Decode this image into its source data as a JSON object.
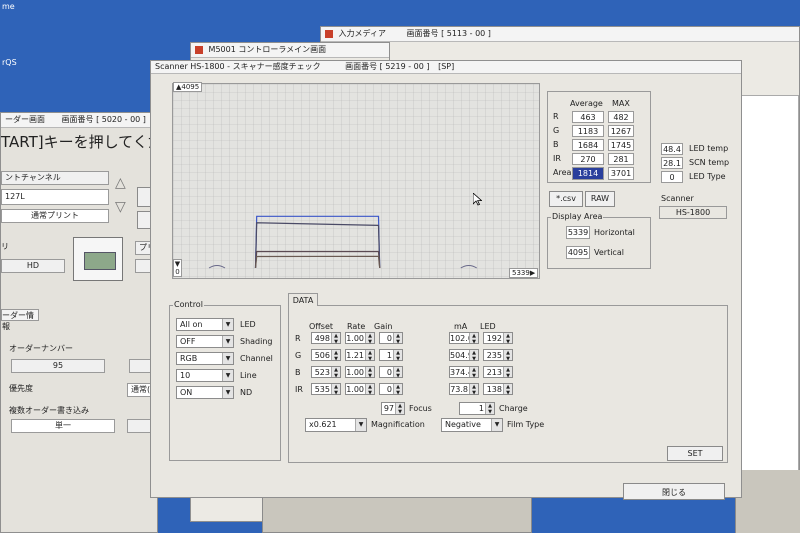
{
  "desktop": {
    "corner_text_1": "me",
    "corner_text_2": "rQS"
  },
  "bg_window_left": {
    "title_suffix": "ーダー画面",
    "screen_no": "画面番号 [ 5020 - 00 ]",
    "prompt": "TART]キーを押してくだ",
    "channel_label": "ントチャンネル",
    "value_127l": "127L",
    "print_mode": "通常プリント",
    "fragment_ri": "リ",
    "hd_value": "HD",
    "fragment_pri": "プリ",
    "order_info_tab": "ーダー情報",
    "order_number_label": "オーダーナンバー",
    "order_number_value": "95",
    "priority_label": "優先度",
    "priority_value": "通常(",
    "multi_order_label": "複数オーダー書き込み",
    "multi_order_value": "単一"
  },
  "bg_window_m5001": {
    "title": "M5001 コントローラメイン画面"
  },
  "bg_window_input": {
    "title": "入力メディア",
    "screen_no": "画面番号 [ 5113 - 00 ]"
  },
  "scanner_window": {
    "title": "Scanner HS-1800 - スキャナー感度チェック",
    "screen_no": "画面番号 [ 5219 - 00 ]",
    "tag": "[SP]",
    "close_button": "閉じる"
  },
  "plot": {
    "y_max_label": "4095",
    "x_max_label": "5339",
    "y_zero_label": "0"
  },
  "chart_data": {
    "type": "line",
    "xlim": [
      0,
      5339
    ],
    "ylim": [
      0,
      4095
    ],
    "grid": true,
    "series": [
      {
        "color": "#3b56c8",
        "points": [
          [
            1100,
            0
          ],
          [
            1120,
            1190
          ],
          [
            3020,
            1190
          ],
          [
            3040,
            0
          ]
        ]
      },
      {
        "color": "#4a4a66",
        "points": [
          [
            1100,
            0
          ],
          [
            1120,
            1040
          ],
          [
            3020,
            980
          ],
          [
            3040,
            0
          ]
        ]
      },
      {
        "color": "#5b4a52",
        "points": [
          [
            1100,
            0
          ],
          [
            1120,
            380
          ],
          [
            3020,
            380
          ],
          [
            3040,
            0
          ]
        ]
      },
      {
        "color": "#6a5a52",
        "points": [
          [
            1100,
            0
          ],
          [
            1120,
            265
          ],
          [
            3020,
            270
          ],
          [
            3040,
            0
          ]
        ]
      }
    ]
  },
  "stats": {
    "header_average": "Average",
    "header_max": "MAX",
    "rows": [
      {
        "label": "R",
        "avg": "463",
        "max": "482"
      },
      {
        "label": "G",
        "avg": "1183",
        "max": "1267"
      },
      {
        "label": "B",
        "avg": "1684",
        "max": "1745"
      },
      {
        "label": "IR",
        "avg": "270",
        "max": "281"
      }
    ],
    "area_label": "Area",
    "area_value": "1814",
    "area_max": "3701"
  },
  "sensors": [
    {
      "value": "48.4",
      "label": "LED temp"
    },
    {
      "value": "28.1",
      "label": "SCN temp"
    },
    {
      "value": "0",
      "label": "LED Type"
    }
  ],
  "buttons": {
    "csv": "*.csv",
    "raw": "RAW",
    "set": "SET"
  },
  "scanner_info": {
    "label": "Scanner",
    "value": "HS-1800"
  },
  "display_area": {
    "title": "Display Area",
    "horizontal_value": "5339",
    "horizontal_label": "Horizontal",
    "vertical_value": "4095",
    "vertical_label": "Vertical"
  },
  "control": {
    "title": "Control",
    "rows": [
      {
        "value": "All on",
        "label": "LED"
      },
      {
        "value": "OFF",
        "label": "Shading"
      },
      {
        "value": "RGB",
        "label": "Channel"
      },
      {
        "value": "10",
        "label": "Line"
      },
      {
        "value": "ON",
        "label": "ND"
      }
    ]
  },
  "data_panel": {
    "tab": "DATA",
    "col_offset": "Offset",
    "col_rate": "Rate",
    "col_gain": "Gain",
    "col_ma": "mA",
    "col_led": "LED",
    "rows": [
      {
        "label": "R",
        "offset": "498",
        "rate": "1.00",
        "gain": "0",
        "ma": "102.0",
        "led": "192"
      },
      {
        "label": "G",
        "offset": "506",
        "rate": "1.21",
        "gain": "1",
        "ma": "504.9",
        "led": "235"
      },
      {
        "label": "B",
        "offset": "523",
        "rate": "1.00",
        "gain": "0",
        "ma": "374.4",
        "led": "213"
      },
      {
        "label": "IR",
        "offset": "535",
        "rate": "1.00",
        "gain": "0",
        "ma": "73.8",
        "led": "138"
      }
    ],
    "focus_value": "97",
    "focus_label": "Focus",
    "charge_value": "1",
    "charge_label": "Charge",
    "magnification_value": "x0.621",
    "magnification_label": "Magnification",
    "film_type_value": "Negative",
    "film_type_label": "Film Type"
  }
}
